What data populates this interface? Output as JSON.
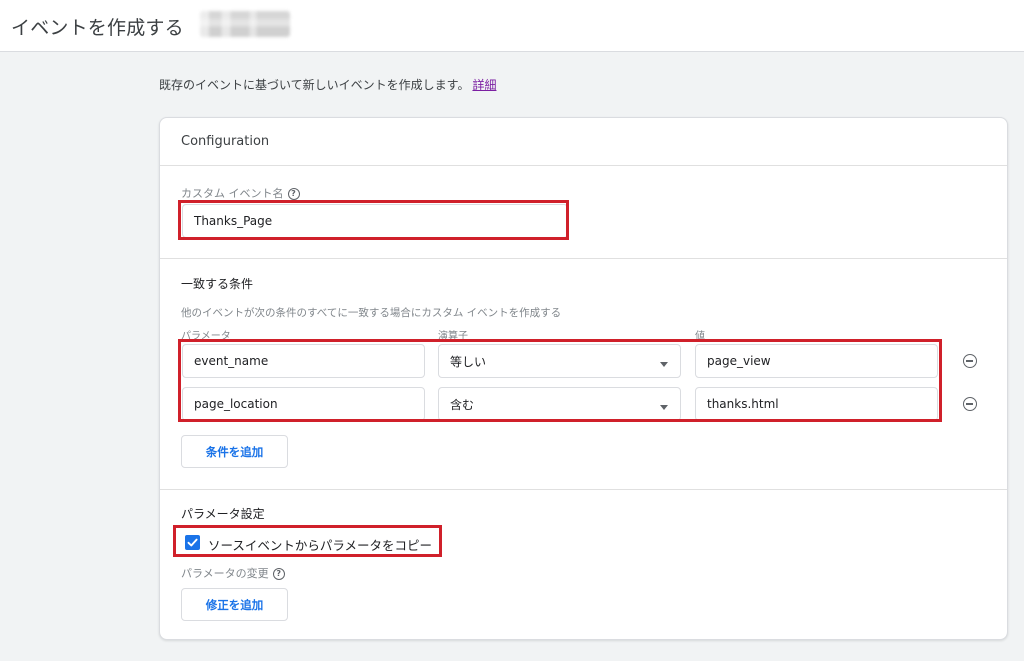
{
  "header": {
    "title": "イベントを作成する"
  },
  "intro": {
    "text": "既存のイベントに基づいて新しいイベントを作成します。",
    "link": "詳細"
  },
  "config": {
    "title": "Configuration",
    "custom_event_label": "カスタム イベント名",
    "custom_event_value": "Thanks_Page"
  },
  "conditions": {
    "title": "一致する条件",
    "description": "他のイベントが次の条件のすべてに一致する場合にカスタム イベントを作成する",
    "col_param": "パラメータ",
    "col_operator": "演算子",
    "col_value": "値",
    "rows": [
      {
        "param": "event_name",
        "operator": "等しい",
        "value": "page_view"
      },
      {
        "param": "page_location",
        "operator": "含む",
        "value": "thanks.html"
      }
    ],
    "add_button": "条件を追加"
  },
  "params": {
    "title": "パラメータ設定",
    "copy_label": "ソースイベントからパラメータをコピー",
    "copy_checked": true,
    "modify_label": "パラメータの変更",
    "add_modification_button": "修正を追加"
  },
  "colors": {
    "accent": "#1a73e8",
    "highlight": "#d0202a",
    "link": "#7b1fa2"
  }
}
